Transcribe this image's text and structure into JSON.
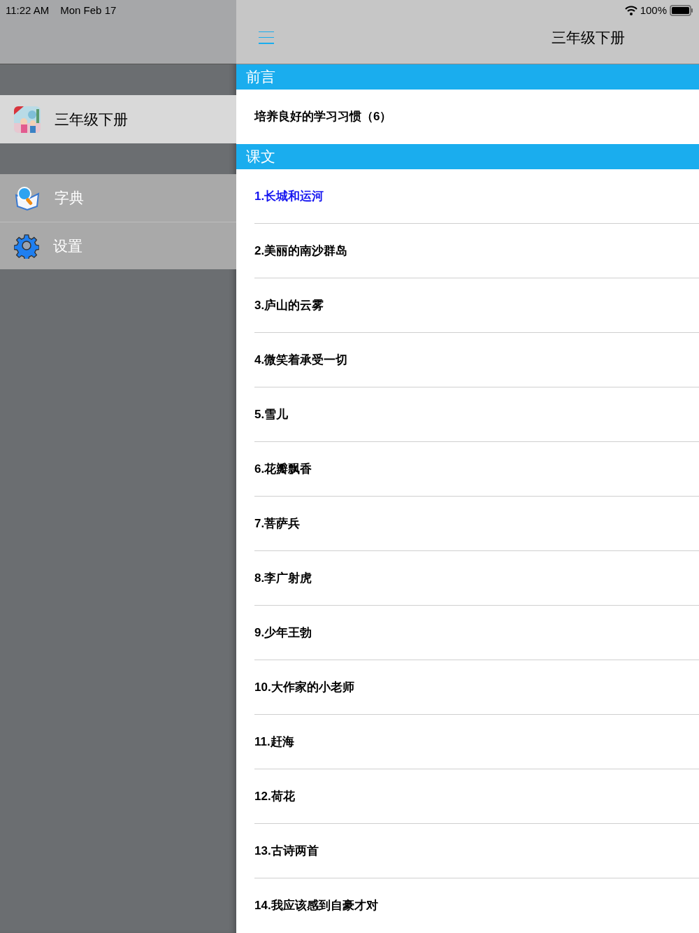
{
  "status_bar": {
    "time": "11:22 AM",
    "date": "Mon Feb 17",
    "battery": "100%"
  },
  "sidebar": {
    "items": [
      {
        "label": "三年级下册",
        "kind": "book",
        "selected": true
      },
      {
        "label": "字典",
        "kind": "dictionary",
        "selected": false
      },
      {
        "label": "设置",
        "kind": "settings",
        "selected": false
      }
    ]
  },
  "nav_bar": {
    "title": "三年级下册"
  },
  "sections": [
    {
      "title": "前言",
      "items": [
        {
          "label": "培养良好的学习习惯（6）",
          "selected": false
        }
      ]
    },
    {
      "title": "课文",
      "items": [
        {
          "label": "1.长城和运河",
          "selected": true
        },
        {
          "label": "2.美丽的南沙群岛",
          "selected": false
        },
        {
          "label": "3.庐山的云雾",
          "selected": false
        },
        {
          "label": "4.微笑着承受一切",
          "selected": false
        },
        {
          "label": "5.雪儿",
          "selected": false
        },
        {
          "label": "6.花瓣飘香",
          "selected": false
        },
        {
          "label": "7.菩萨兵",
          "selected": false
        },
        {
          "label": "8.李广射虎",
          "selected": false
        },
        {
          "label": "9.少年王勃",
          "selected": false
        },
        {
          "label": "10.大作家的小老师",
          "selected": false
        },
        {
          "label": "11.赶海",
          "selected": false
        },
        {
          "label": "12.荷花",
          "selected": false
        },
        {
          "label": "13.古诗两首",
          "selected": false
        },
        {
          "label": "14.我应该感到自豪才对",
          "selected": false
        }
      ]
    }
  ]
}
